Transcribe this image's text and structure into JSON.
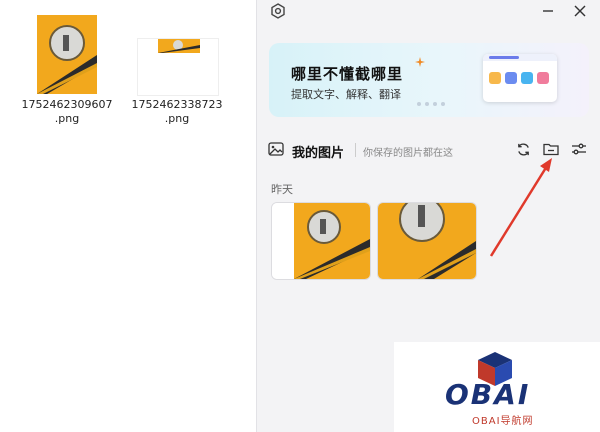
{
  "explorer": {
    "files": [
      {
        "name_line1": "1752462309607",
        "name_line2": ".png"
      },
      {
        "name_line1": "1752462338723",
        "name_line2": ".png"
      }
    ]
  },
  "panel": {
    "icons": {
      "settings": "settings-icon",
      "minimize": "minimize-icon",
      "close": "close-icon"
    },
    "banner": {
      "title": "哪里不懂截哪里",
      "subtitle": "提取文字、解释、翻译"
    },
    "section": {
      "title": "我的图片",
      "hint": "你保存的图片都在这"
    },
    "date_group": "昨天",
    "accent_color": "#f5a623",
    "arrow_color": "#e0392b"
  },
  "watermark": {
    "text": "OBAI",
    "sub": "OBAI导航网"
  }
}
